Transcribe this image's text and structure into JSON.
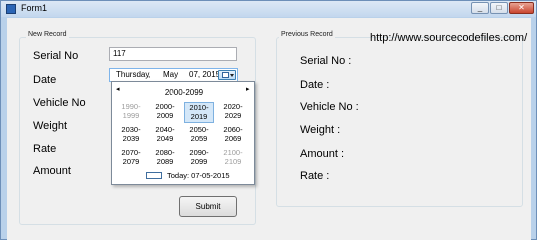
{
  "window": {
    "title": "Form1",
    "minimize": "_",
    "maximize": "□",
    "close": "✕"
  },
  "new_record": {
    "title": "New Record",
    "labels": {
      "serial": "Serial No",
      "date": "Date",
      "vehicle": "Vehicle No",
      "weight": "Weight",
      "rate": "Rate",
      "amount": "Amount"
    },
    "serial_value": "117",
    "date_picker": {
      "weekday": "Thursday",
      "sep": ",",
      "month": "May",
      "dayyear": "07, 2015"
    },
    "submit_label": "Submit"
  },
  "calendar": {
    "prev": "◂",
    "next": "▸",
    "header": "2000-2099",
    "cells": [
      {
        "line1": "1990-",
        "line2": "1999",
        "state": "dim"
      },
      {
        "line1": "2000-",
        "line2": "2009",
        "state": "normal"
      },
      {
        "line1": "2010-",
        "line2": "2019",
        "state": "selected"
      },
      {
        "line1": "2020-",
        "line2": "2029",
        "state": "normal"
      },
      {
        "line1": "2030-",
        "line2": "2039",
        "state": "normal"
      },
      {
        "line1": "2040-",
        "line2": "2049",
        "state": "normal"
      },
      {
        "line1": "2050-",
        "line2": "2059",
        "state": "normal"
      },
      {
        "line1": "2060-",
        "line2": "2069",
        "state": "normal"
      },
      {
        "line1": "2070-",
        "line2": "2079",
        "state": "normal"
      },
      {
        "line1": "2080-",
        "line2": "2089",
        "state": "normal"
      },
      {
        "line1": "2090-",
        "line2": "2099",
        "state": "normal"
      },
      {
        "line1": "2100-",
        "line2": "2109",
        "state": "dim"
      }
    ],
    "today": "Today: 07-05-2015"
  },
  "previous_record": {
    "title": "Previous Record",
    "url": "http://www.sourcecodefiles.com/",
    "labels": {
      "serial": "Serial No :",
      "date": "Date :",
      "vehicle": "Vehicle No :",
      "weight": "Weight :",
      "amount": "Amount :",
      "rate": "Rate :"
    }
  },
  "colors": {
    "form_bg": "#f0f0f0",
    "selected_cell": "#d4e7f8",
    "frame": "#b9d1ea"
  }
}
